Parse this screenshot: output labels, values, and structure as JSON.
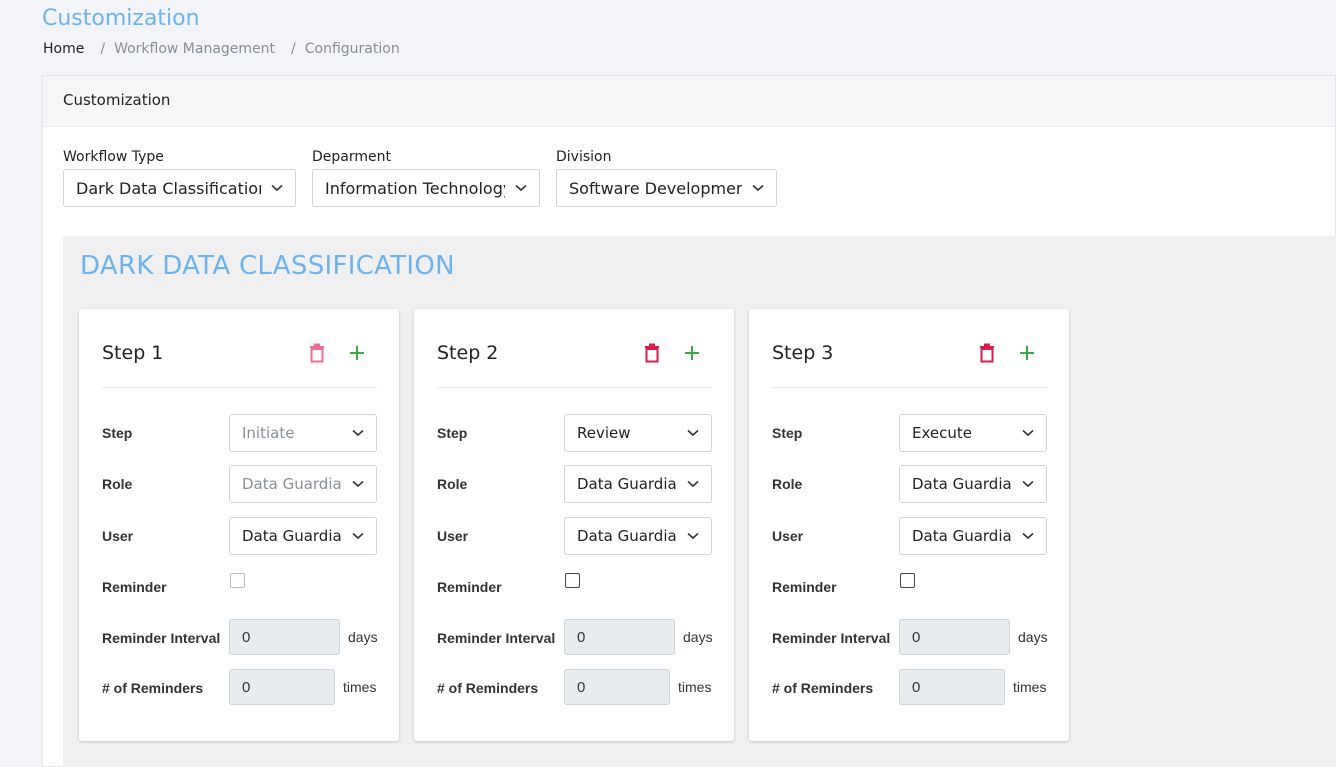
{
  "page": {
    "title": "Customization",
    "breadcrumb": [
      "Home",
      "Workflow Management",
      "Configuration"
    ]
  },
  "card": {
    "header": "Customization"
  },
  "filters": [
    {
      "label": "Workflow Type",
      "value": "Dark Data Classification"
    },
    {
      "label": "Deparment",
      "value": "Information Technology"
    },
    {
      "label": "Division",
      "value": "Software Development"
    }
  ],
  "workflow": {
    "title": "DARK DATA CLASSIFICATION"
  },
  "labels": {
    "step": "Step",
    "role": "Role",
    "user": "User",
    "reminder": "Reminder",
    "reminder_interval": "Reminder Interval",
    "num_reminders": "# of Reminders",
    "days": "days",
    "times": "times"
  },
  "steps": [
    {
      "title": "Step 1",
      "step": "Initiate",
      "role": "Data Guardiar",
      "user": "Data Guardiar",
      "reminder_checked": false,
      "reminder_interval": "0",
      "num_reminders": "0",
      "disabled": true
    },
    {
      "title": "Step 2",
      "step": "Review",
      "role": "Data Guardiar",
      "user": "Data Guardiar",
      "reminder_checked": false,
      "reminder_interval": "0",
      "num_reminders": "0",
      "disabled": false
    },
    {
      "title": "Step 3",
      "step": "Execute",
      "role": "Data Guardiar",
      "user": "Data Guardiar",
      "reminder_checked": false,
      "reminder_interval": "0",
      "num_reminders": "0",
      "disabled": false
    }
  ],
  "icons": {
    "delete": "trash-icon",
    "add": "plus-icon",
    "dropdown": "chevron-down-icon"
  },
  "colors": {
    "accent": "#6cb4f0",
    "delete_active": "#d81b4a",
    "delete_disabled": "#ee6e92",
    "add": "#3aaa46"
  }
}
